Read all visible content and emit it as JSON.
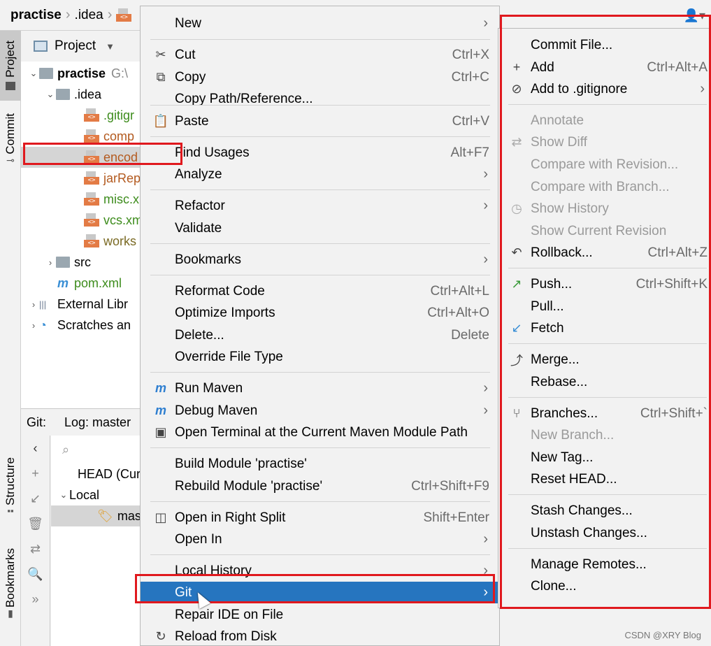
{
  "breadcrumb": {
    "root": "practise",
    "folder": ".idea"
  },
  "left_strip": {
    "project": "Project",
    "commit": "Commit",
    "structure": "Structure",
    "bookmarks": "Bookmarks"
  },
  "project_panel": {
    "title": "Project",
    "tree": [
      {
        "label": "practise",
        "extra": "G:\\",
        "indent": 0,
        "arrow": "⌄"
      },
      {
        "label": ".idea",
        "indent": 1,
        "arrow": "⌄"
      },
      {
        "label": ".gitigr",
        "indent": 2,
        "color": "green"
      },
      {
        "label": "comp",
        "indent": 2,
        "color": "orange"
      },
      {
        "label": "encod",
        "indent": 2,
        "color": "orange",
        "selected": true
      },
      {
        "label": "jarRep",
        "indent": 2,
        "color": "orange"
      },
      {
        "label": "misc.x",
        "indent": 2,
        "color": "green"
      },
      {
        "label": "vcs.xm",
        "indent": 2,
        "color": "green"
      },
      {
        "label": "works",
        "indent": 2,
        "color": "olive"
      },
      {
        "label": "src",
        "indent": 1,
        "arrow": "›"
      },
      {
        "label": "pom.xml",
        "indent": 1,
        "color": "green"
      },
      {
        "label": "External Libr",
        "indent": 0,
        "arrow": "›"
      },
      {
        "label": "Scratches an",
        "indent": 0,
        "arrow": "›"
      }
    ]
  },
  "git_panel": {
    "tab_git": "Git:",
    "tab_log": "Log: master",
    "head_row": "HEAD (Cur",
    "local_row": "Local",
    "branch_row": "mas"
  },
  "context_menu": {
    "items": [
      {
        "label": "New",
        "shortcut": "",
        "sub": true,
        "icon": ""
      },
      {
        "label": "Cut",
        "shortcut": "Ctrl+X",
        "icon": "✂"
      },
      {
        "label": "Copy",
        "shortcut": "Ctrl+C",
        "icon": "⧉"
      },
      {
        "label": "Copy Path/Reference...",
        "shortcut": "",
        "icon": ""
      },
      {
        "label": "Paste",
        "shortcut": "Ctrl+V",
        "icon": "📋"
      },
      {
        "label": "Find Usages",
        "shortcut": "Alt+F7",
        "icon": ""
      },
      {
        "label": "Analyze",
        "shortcut": "",
        "sub": true,
        "icon": ""
      },
      {
        "label": "Refactor",
        "shortcut": "",
        "sub": true,
        "icon": ""
      },
      {
        "label": "Validate",
        "shortcut": "",
        "icon": ""
      },
      {
        "label": "Bookmarks",
        "shortcut": "",
        "sub": true,
        "icon": ""
      },
      {
        "label": "Reformat Code",
        "shortcut": "Ctrl+Alt+L",
        "icon": ""
      },
      {
        "label": "Optimize Imports",
        "shortcut": "Ctrl+Alt+O",
        "icon": ""
      },
      {
        "label": "Delete...",
        "shortcut": "Delete",
        "icon": ""
      },
      {
        "label": "Override File Type",
        "shortcut": "",
        "icon": ""
      },
      {
        "label": "Run Maven",
        "shortcut": "",
        "sub": true,
        "icon": "m"
      },
      {
        "label": "Debug Maven",
        "shortcut": "",
        "sub": true,
        "icon": "m"
      },
      {
        "label": "Open Terminal at the Current Maven Module Path",
        "shortcut": "",
        "icon": "▣"
      },
      {
        "label": "Build Module 'practise'",
        "shortcut": "",
        "icon": ""
      },
      {
        "label": "Rebuild Module 'practise'",
        "shortcut": "Ctrl+Shift+F9",
        "icon": ""
      },
      {
        "label": "Open in Right Split",
        "shortcut": "Shift+Enter",
        "icon": "◫"
      },
      {
        "label": "Open In",
        "shortcut": "",
        "sub": true,
        "icon": ""
      },
      {
        "label": "Local History",
        "shortcut": "",
        "sub": true,
        "icon": ""
      },
      {
        "label": "Git",
        "shortcut": "",
        "sub": true,
        "icon": "",
        "highlighted": true
      },
      {
        "label": "Repair IDE on File",
        "shortcut": "",
        "icon": ""
      },
      {
        "label": "Reload from Disk",
        "shortcut": "",
        "icon": "↻"
      }
    ]
  },
  "git_submenu": {
    "items": [
      {
        "label": "Commit File...",
        "shortcut": "",
        "icon": ""
      },
      {
        "label": "Add",
        "shortcut": "Ctrl+Alt+A",
        "icon": "+"
      },
      {
        "label": "Add to .gitignore",
        "shortcut": "",
        "sub": true,
        "icon": "⊘"
      },
      {
        "label": "Annotate",
        "shortcut": "",
        "disabled": true,
        "icon": ""
      },
      {
        "label": "Show Diff",
        "shortcut": "",
        "disabled": true,
        "icon": "⇄"
      },
      {
        "label": "Compare with Revision...",
        "shortcut": "",
        "disabled": true,
        "icon": ""
      },
      {
        "label": "Compare with Branch...",
        "shortcut": "",
        "disabled": true,
        "icon": ""
      },
      {
        "label": "Show History",
        "shortcut": "",
        "disabled": true,
        "icon": "◷"
      },
      {
        "label": "Show Current Revision",
        "shortcut": "",
        "disabled": true,
        "icon": ""
      },
      {
        "label": "Rollback...",
        "shortcut": "Ctrl+Alt+Z",
        "icon": "↶"
      },
      {
        "label": "Push...",
        "shortcut": "Ctrl+Shift+K",
        "icon": "↗"
      },
      {
        "label": "Pull...",
        "shortcut": "",
        "icon": ""
      },
      {
        "label": "Fetch",
        "shortcut": "",
        "icon": "↙"
      },
      {
        "label": "Merge...",
        "shortcut": "",
        "icon": "⤴"
      },
      {
        "label": "Rebase...",
        "shortcut": "",
        "icon": ""
      },
      {
        "label": "Branches...",
        "shortcut": "Ctrl+Shift+`",
        "icon": "⑂"
      },
      {
        "label": "New Branch...",
        "shortcut": "",
        "disabled": true,
        "icon": ""
      },
      {
        "label": "New Tag...",
        "shortcut": "",
        "icon": ""
      },
      {
        "label": "Reset HEAD...",
        "shortcut": "",
        "icon": ""
      },
      {
        "label": "Stash Changes...",
        "shortcut": "",
        "icon": ""
      },
      {
        "label": "Unstash Changes...",
        "shortcut": "",
        "icon": ""
      },
      {
        "label": "Manage Remotes...",
        "shortcut": "",
        "icon": ""
      },
      {
        "label": "Clone...",
        "shortcut": "",
        "icon": ""
      }
    ]
  },
  "watermark": "CSDN @XRY Blog",
  "colors": {
    "highlight": "#2675bf",
    "annotation": "#e0191e"
  }
}
